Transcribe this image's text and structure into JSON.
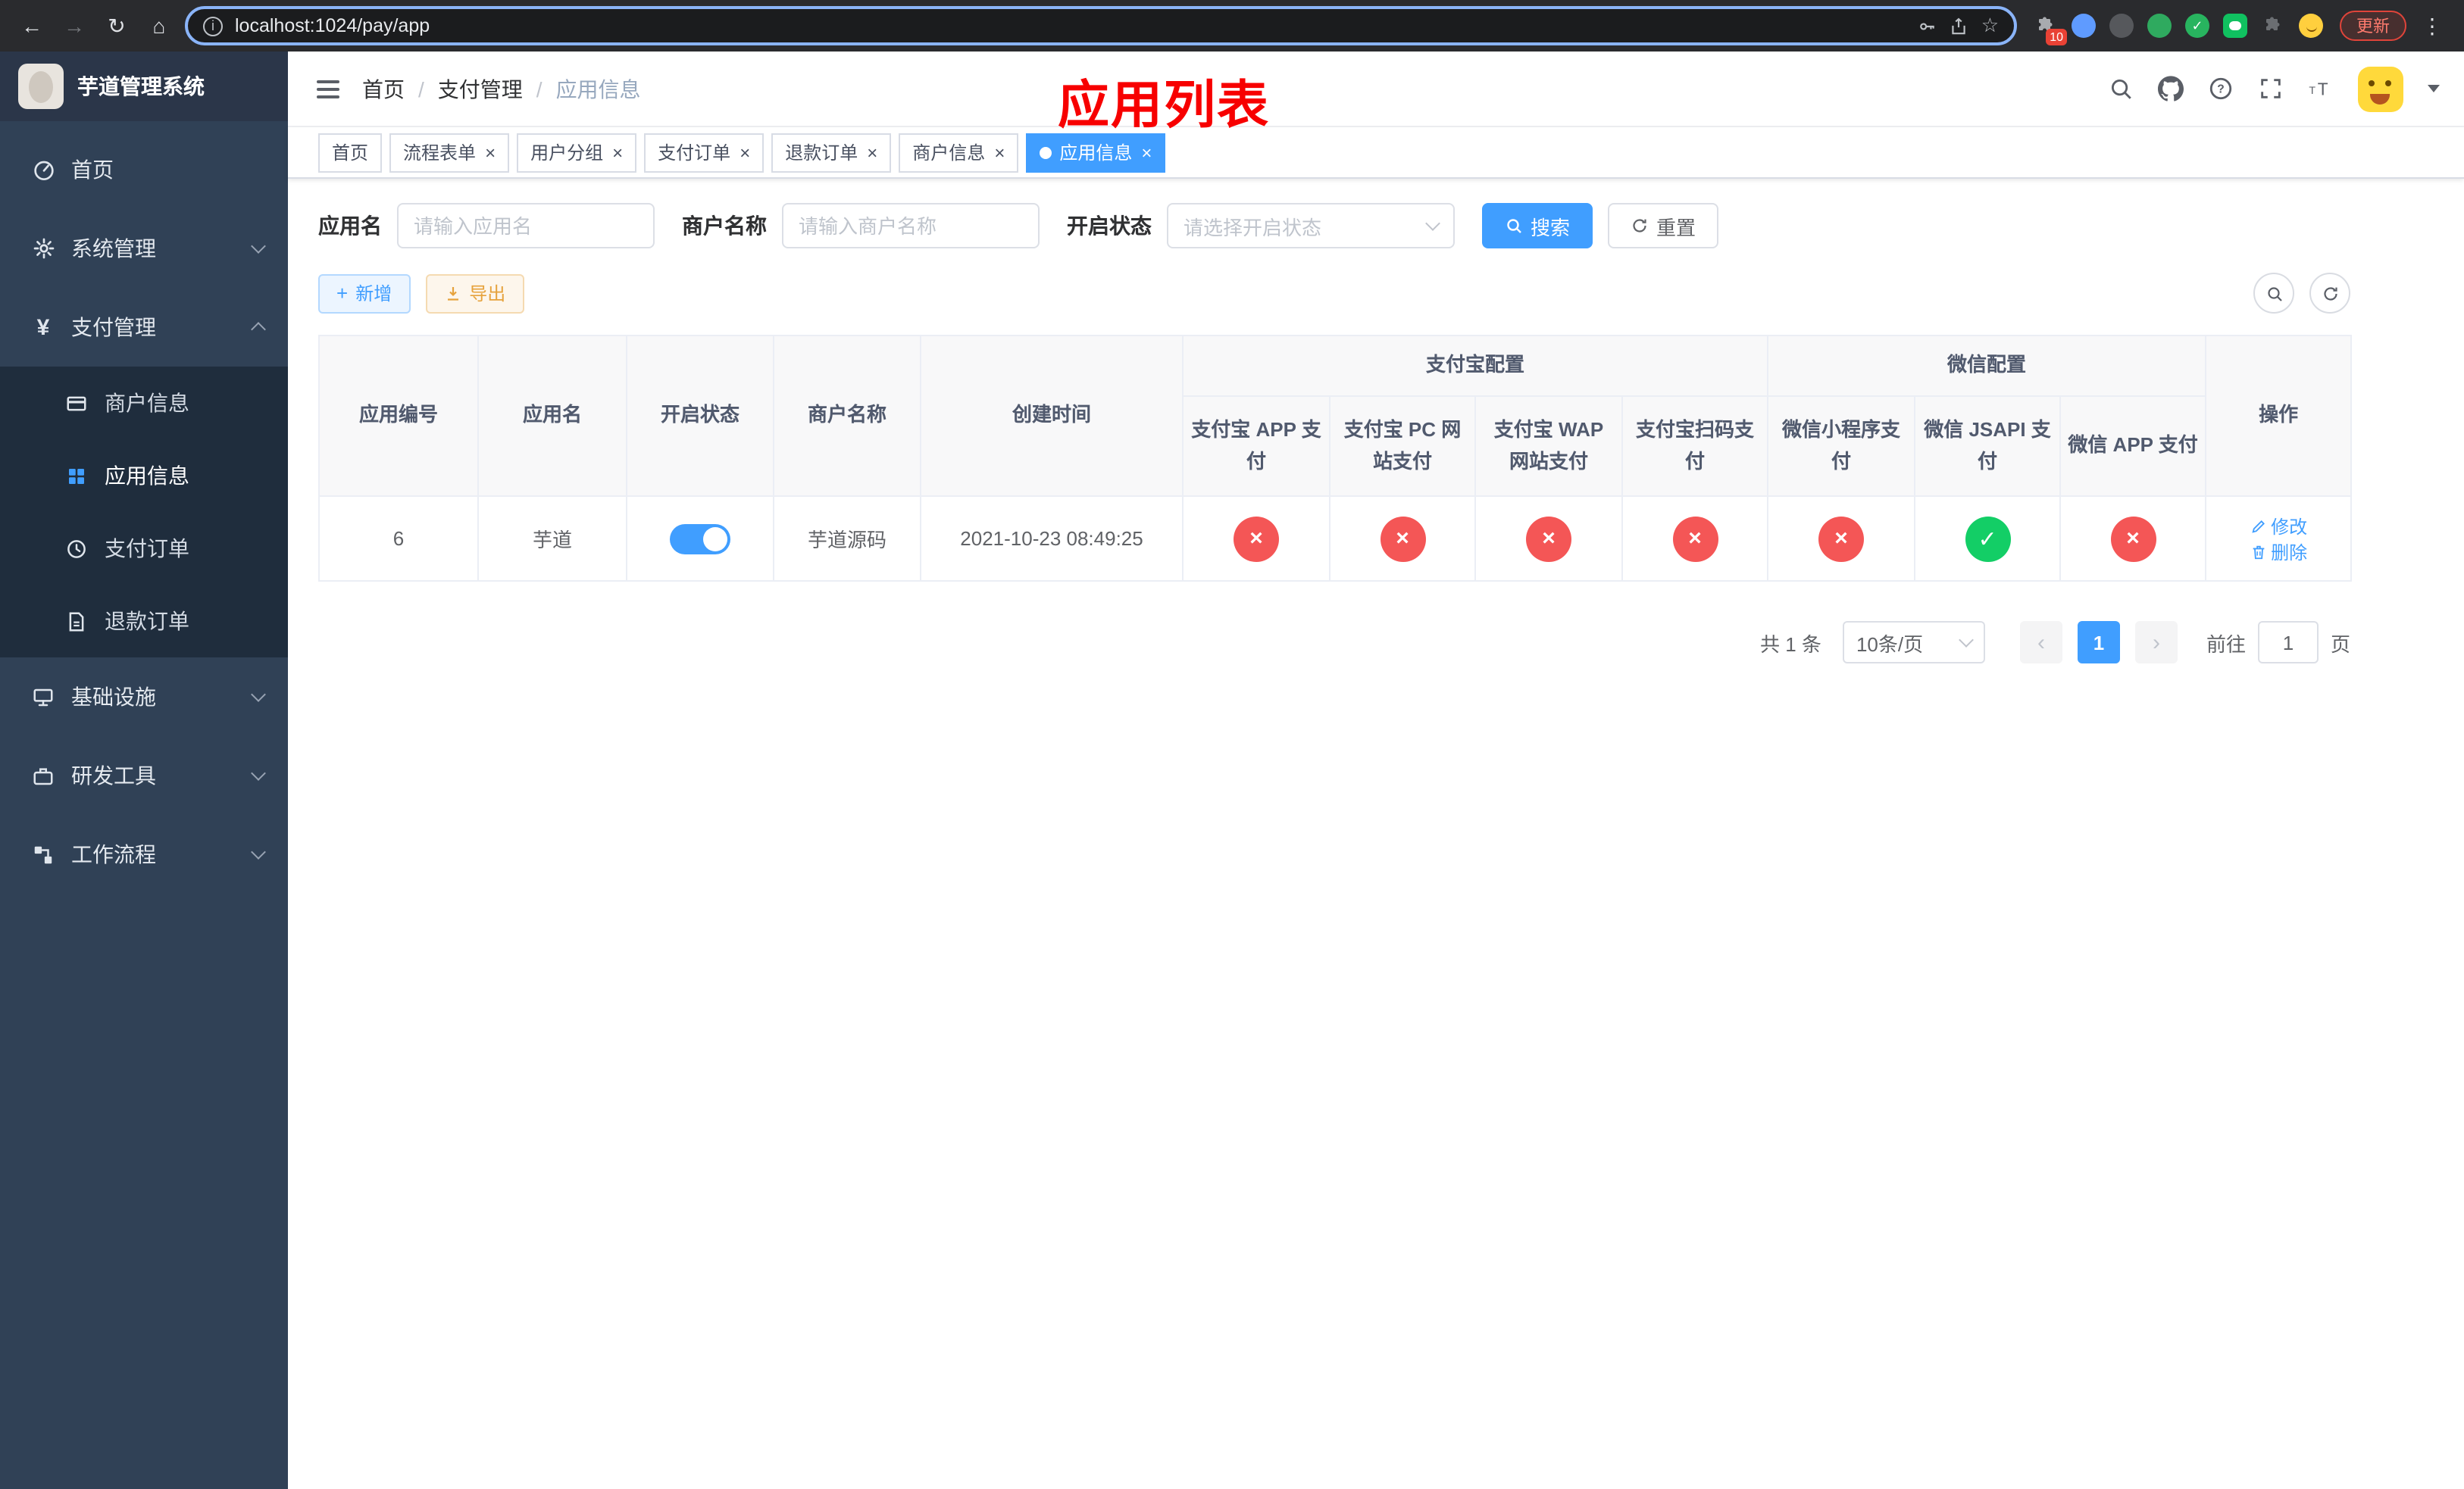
{
  "colors": {
    "primary": "#409eff",
    "success": "#13ce66",
    "danger": "#f45656",
    "warning": "#e6a23c",
    "annotation_red": "#f70000",
    "sidebar_bg": "#304156",
    "submenu_bg": "#1f2d3d"
  },
  "icons": {
    "back": "←",
    "forward": "→",
    "reload": "↻",
    "home": "⌂",
    "info": "i",
    "star": "☆",
    "more": "⋮",
    "check": "✓",
    "cross": "×",
    "plus": "+",
    "prev": "‹",
    "next": "›"
  },
  "browser": {
    "url": "localhost:1024/pay/app",
    "update_label": "更新",
    "extension_badge": "10"
  },
  "sidebar": {
    "title": "芋道管理系统",
    "items": [
      {
        "key": "home",
        "label": "首页",
        "icon": "dashboard-icon"
      },
      {
        "key": "system",
        "label": "系统管理",
        "icon": "gear-icon",
        "chevron": true,
        "expanded": false
      },
      {
        "key": "payment",
        "label": "支付管理",
        "icon": "yen-icon",
        "chevron": true,
        "expanded": true,
        "children": [
          {
            "key": "merchant-info",
            "label": "商户信息",
            "icon": "card-icon",
            "active": false
          },
          {
            "key": "app-info",
            "label": "应用信息",
            "icon": "grid-icon",
            "active": true
          },
          {
            "key": "pay-order",
            "label": "支付订单",
            "icon": "order-icon",
            "active": false
          },
          {
            "key": "refund-order",
            "label": "退款订单",
            "icon": "refund-icon",
            "active": false
          }
        ]
      },
      {
        "key": "infra",
        "label": "基础设施",
        "icon": "infra-icon",
        "chevron": true,
        "expanded": false
      },
      {
        "key": "devtools",
        "label": "研发工具",
        "icon": "tools-icon",
        "chevron": true,
        "expanded": false
      },
      {
        "key": "workflow",
        "label": "工作流程",
        "icon": "workflow-icon",
        "chevron": true,
        "expanded": false
      }
    ]
  },
  "annotation": {
    "title": "应用列表"
  },
  "breadcrumb": [
    "首页",
    "支付管理",
    "应用信息"
  ],
  "tabs": [
    {
      "label": "首页",
      "closable": false,
      "active": false
    },
    {
      "label": "流程表单",
      "closable": true,
      "active": false
    },
    {
      "label": "用户分组",
      "closable": true,
      "active": false
    },
    {
      "label": "支付订单",
      "closable": true,
      "active": false
    },
    {
      "label": "退款订单",
      "closable": true,
      "active": false
    },
    {
      "label": "商户信息",
      "closable": true,
      "active": false
    },
    {
      "label": "应用信息",
      "closable": true,
      "active": true
    }
  ],
  "filters": {
    "app_name_label": "应用名",
    "app_name_placeholder": "请输入应用名",
    "merchant_label": "商户名称",
    "merchant_placeholder": "请输入商户名称",
    "status_label": "开启状态",
    "status_placeholder": "请选择开启状态",
    "search_label": "搜索",
    "reset_label": "重置"
  },
  "toolbar": {
    "add_label": "新增",
    "export_label": "导出"
  },
  "table": {
    "leading_columns": [
      "应用编号",
      "应用名",
      "开启状态",
      "商户名称",
      "创建时间"
    ],
    "groups": [
      {
        "label": "支付宝配置",
        "children": [
          "支付宝 APP 支付",
          "支付宝 PC 网站支付",
          "支付宝 WAP 网站支付",
          "支付宝扫码支付"
        ]
      },
      {
        "label": "微信配置",
        "children": [
          "微信小程序支付",
          "微信 JSAPI 支付",
          "微信 APP 支付"
        ]
      }
    ],
    "action_column": "操作",
    "row": {
      "id": "6",
      "name": "芋道",
      "enabled": true,
      "merchant": "芋道源码",
      "created": "2021-10-23 08:49:25",
      "configs": [
        false,
        false,
        false,
        false,
        false,
        true,
        false
      ],
      "edit_label": "修改",
      "delete_label": "删除"
    }
  },
  "pagination": {
    "total_text": "共 1 条",
    "page_size": "10条/页",
    "current_page": "1",
    "goto_label": "前往",
    "goto_value": "1",
    "page_suffix": "页"
  }
}
